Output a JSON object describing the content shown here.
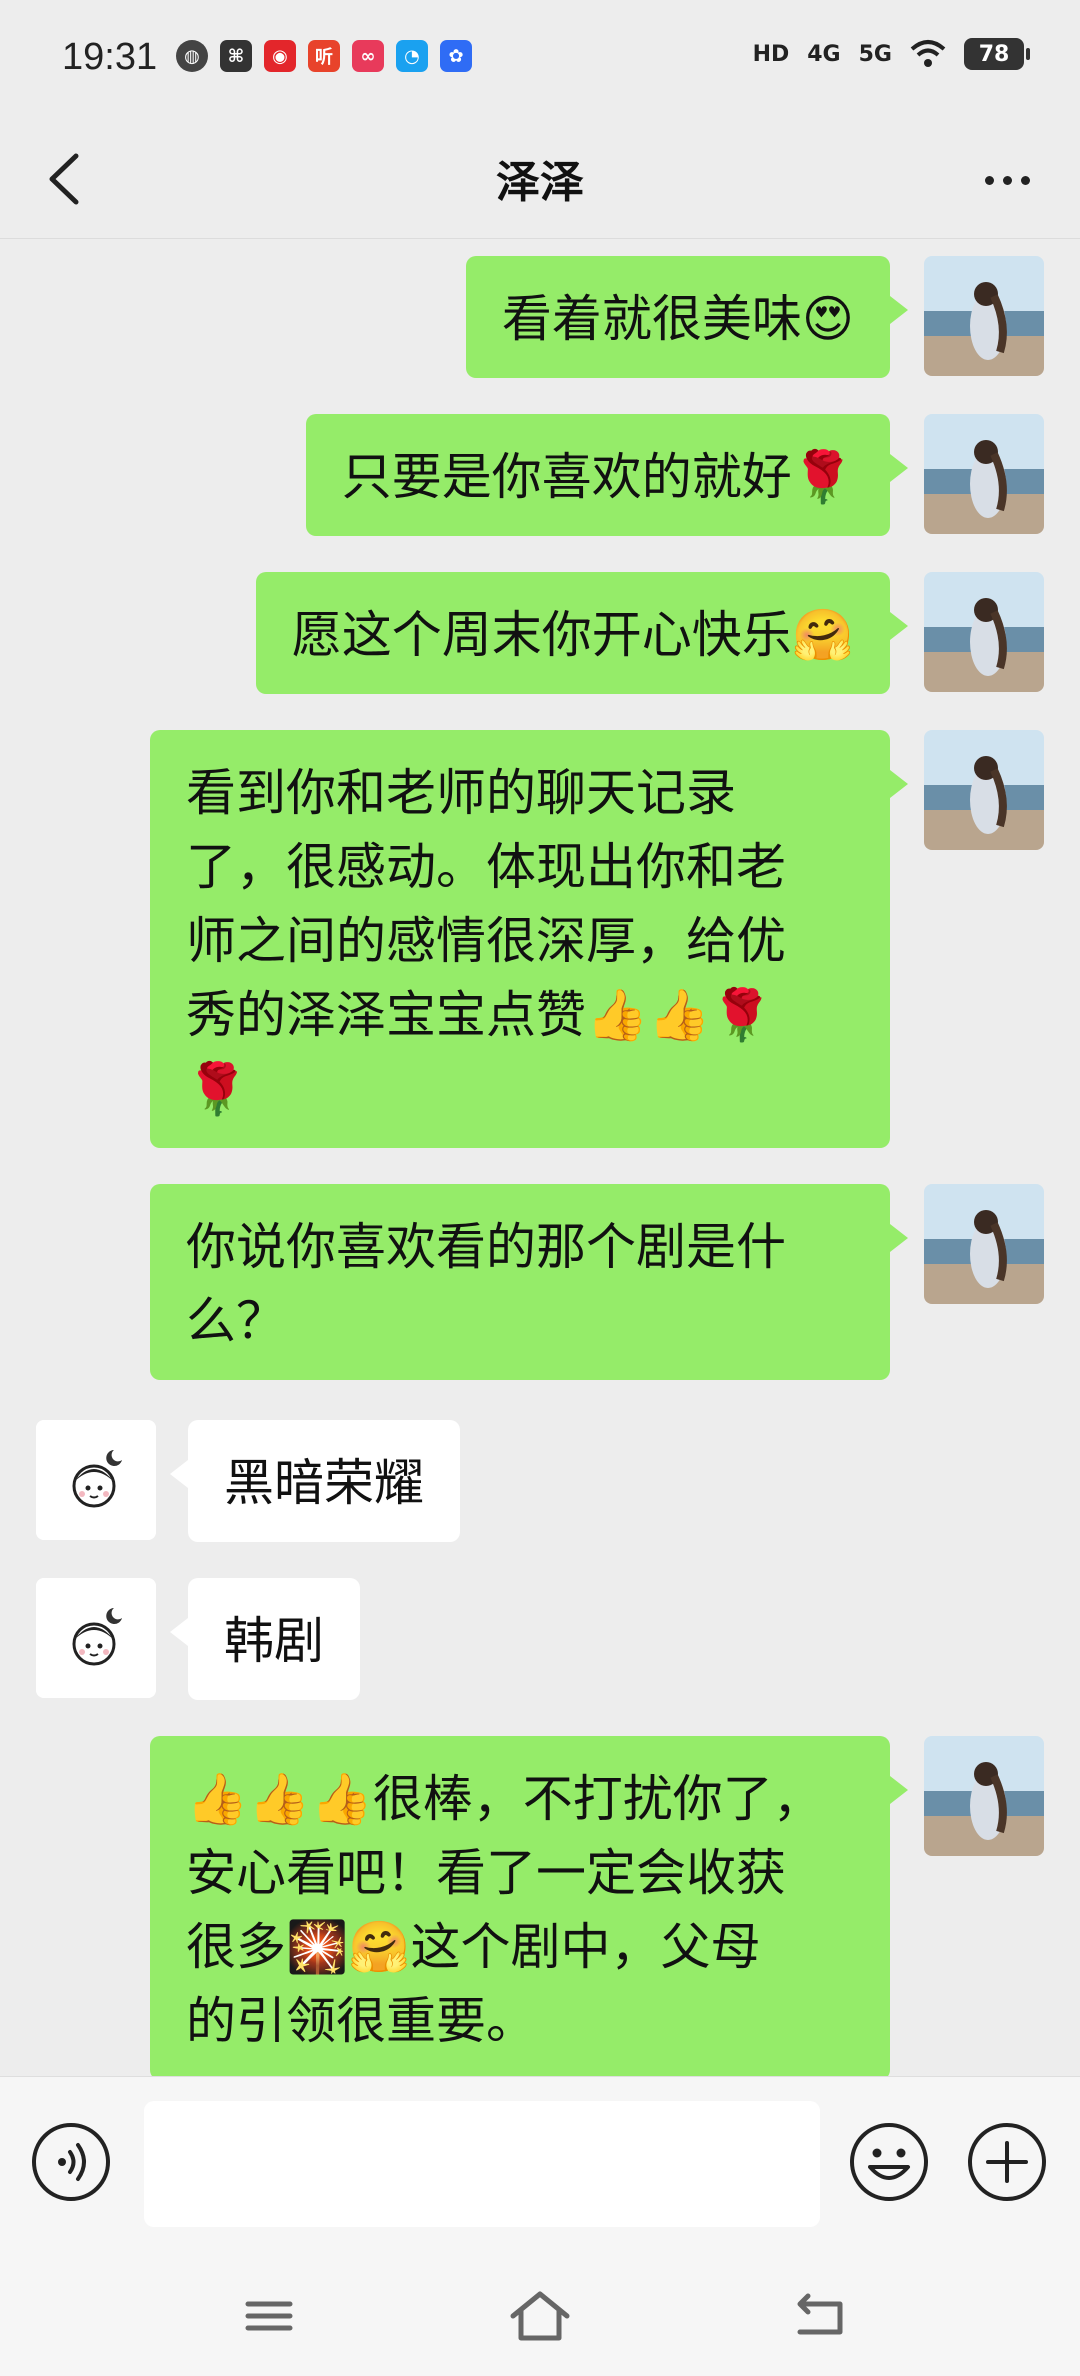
{
  "status_bar": {
    "time": "19:31",
    "app_icons": [
      "globe-icon",
      "app-icon",
      "netease-music-icon",
      "ting-icon",
      "chat-app-icon",
      "qq-icon",
      "baidu-icon"
    ],
    "network_labels": [
      "HD",
      "4G",
      "5G"
    ],
    "battery": "78"
  },
  "header": {
    "title": "泽泽",
    "back_icon": "chevron-left-icon",
    "more_icon": "more-icon"
  },
  "messages": [
    {
      "sender": "me",
      "text": "看着就很美味😍"
    },
    {
      "sender": "me",
      "text": "只要是你喜欢的就好🌹"
    },
    {
      "sender": "me",
      "text": "愿这个周末你开心快乐🤗"
    },
    {
      "sender": "me",
      "text": "看到你和老师的聊天记录\n了，很感动。体现出你和老\n师之间的感情很深厚，给优\n秀的泽泽宝宝点赞👍👍🌹\n🌹"
    },
    {
      "sender": "me",
      "text": "你说你喜欢看的那个剧是什\n么？"
    },
    {
      "sender": "her",
      "text": "黑暗荣耀"
    },
    {
      "sender": "her",
      "text": "韩剧"
    },
    {
      "sender": "me",
      "text": "👍👍👍很棒，不打扰你了，\n安心看吧！看了一定会收获\n很多🎇🤗这个剧中，父母\n的引领很重要。"
    }
  ],
  "input_bar": {
    "voice_icon": "voice-icon",
    "emoji_icon": "emoji-icon",
    "plus_icon": "plus-icon",
    "message_value": ""
  },
  "nav_bar": {
    "icons": [
      "menu-icon",
      "home-icon",
      "back-icon"
    ]
  },
  "colors": {
    "my_bubble": "#95ec69",
    "her_bubble": "#ffffff",
    "background": "#ededed"
  }
}
